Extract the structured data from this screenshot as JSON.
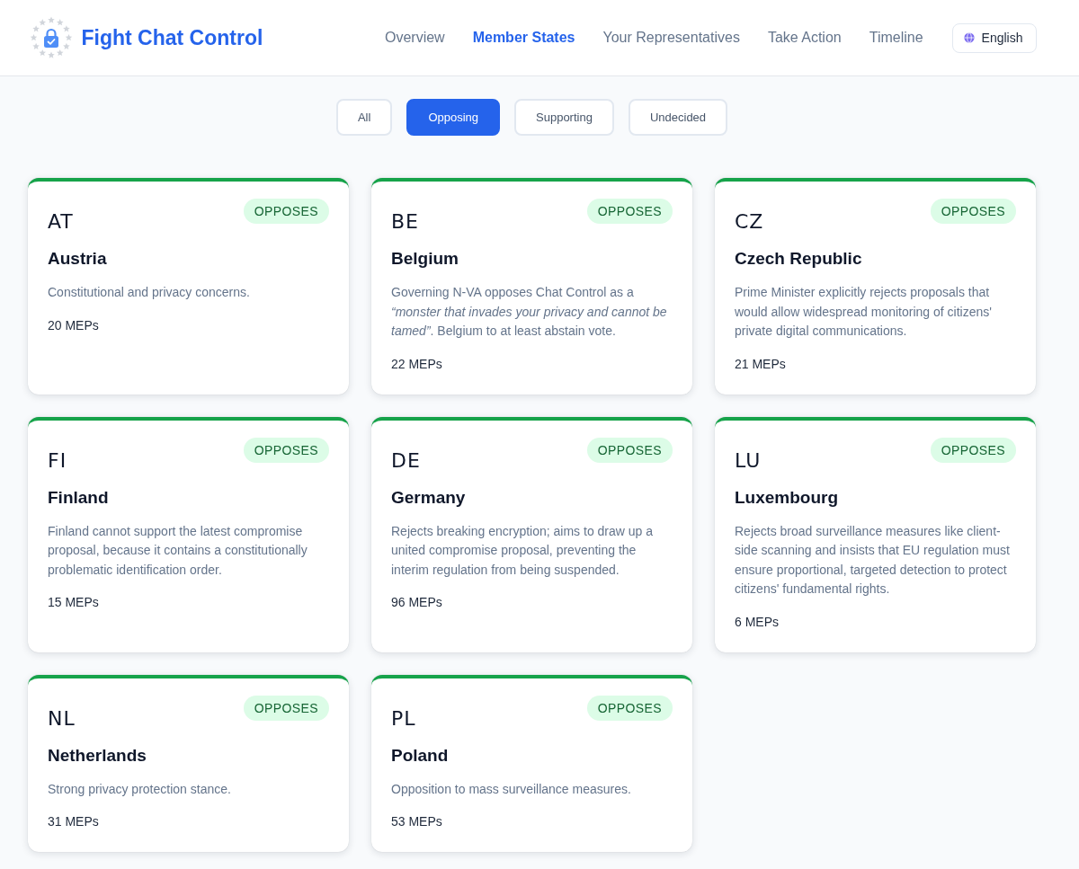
{
  "header": {
    "logo_text": "Fight Chat Control",
    "nav": [
      {
        "label": "Overview",
        "selected": false
      },
      {
        "label": "Member States",
        "selected": true
      },
      {
        "label": "Your Representatives",
        "selected": false
      },
      {
        "label": "Take Action",
        "selected": false
      },
      {
        "label": "Timeline",
        "selected": false
      }
    ],
    "language_button": {
      "label": "English"
    }
  },
  "filters": [
    {
      "label": "All",
      "selected": false
    },
    {
      "label": "Opposing",
      "selected": true
    },
    {
      "label": "Supporting",
      "selected": false
    },
    {
      "label": "Undecided",
      "selected": false
    }
  ],
  "countries": [
    {
      "code": "AT",
      "name": "Austria",
      "kind": "opposes",
      "badge": "OPPOSES",
      "description": "Constitutional and privacy concerns.",
      "meps": "20 MEPs"
    },
    {
      "code": "BE",
      "name": "Belgium",
      "kind": "opposes",
      "badge": "OPPOSES",
      "description": "Governing N-VA opposes Chat Control as a *“monster that invades your privacy and cannot be tamed”*. Belgium to at least abstain vote.",
      "meps": "22 MEPs"
    },
    {
      "code": "CZ",
      "name": "Czech Republic",
      "kind": "opposes",
      "badge": "OPPOSES",
      "description": "Prime Minister explicitly rejects proposals that would allow widespread monitoring of citizens' private digital communications.",
      "meps": "21 MEPs"
    },
    {
      "code": "FI",
      "name": "Finland",
      "kind": "opposes",
      "badge": "OPPOSES",
      "description": "Finland cannot support the latest compromise proposal, because it contains a constitutionally problematic identification order.",
      "meps": "15 MEPs"
    },
    {
      "code": "DE",
      "name": "Germany",
      "kind": "opposes",
      "badge": "OPPOSES",
      "description": "Rejects breaking encryption; aims to draw up a united compromise proposal, preventing the interim regulation from being suspended.",
      "meps": "96 MEPs"
    },
    {
      "code": "LU",
      "name": "Luxembourg",
      "kind": "opposes",
      "badge": "OPPOSES",
      "description": "Rejects broad surveillance measures like client-side scanning and insists that EU regulation must ensure proportional, targeted detection to protect citizens' fundamental rights.",
      "meps": "6 MEPs"
    },
    {
      "code": "NL",
      "name": "Netherlands",
      "kind": "opposes",
      "badge": "OPPOSES",
      "description": "Strong privacy protection stance.",
      "meps": "31 MEPs"
    },
    {
      "code": "PL",
      "name": "Poland",
      "kind": "opposes",
      "badge": "OPPOSES",
      "description": "Opposition to mass surveillance measures.",
      "meps": "53 MEPs"
    }
  ]
}
